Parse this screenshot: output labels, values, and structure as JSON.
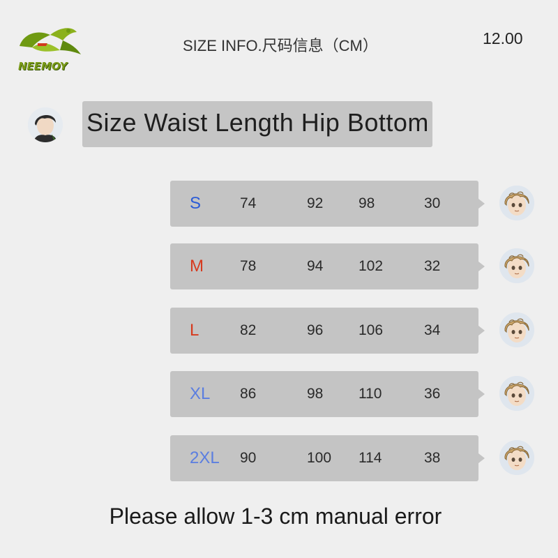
{
  "brand": {
    "logo_text": "NEEMOY",
    "logo_color": "#7a9a18"
  },
  "header": {
    "title": "SIZE INFO.尺码信息（CM）",
    "price": "12.00"
  },
  "columns": {
    "line": "Size Waist Length Hip Bottom"
  },
  "rows": [
    {
      "size": "S",
      "color": "#2a5bd7",
      "waist": "74",
      "length": "92",
      "hip": "98",
      "bottom": "30"
    },
    {
      "size": "M",
      "color": "#d63a1e",
      "waist": "78",
      "length": "94",
      "hip": "102",
      "bottom": "32"
    },
    {
      "size": "L",
      "color": "#d63a1e",
      "waist": "82",
      "length": "96",
      "hip": "106",
      "bottom": "34"
    },
    {
      "size": "XL",
      "color": "#5b7ee0",
      "waist": "86",
      "length": "98",
      "hip": "110",
      "bottom": "36"
    },
    {
      "size": "2XL",
      "color": "#5b7ee0",
      "waist": "90",
      "length": "100",
      "hip": "114",
      "bottom": "38"
    }
  ],
  "footer": {
    "note": "Please allow 1-3 cm manual error"
  },
  "icons": {
    "header_avatar": "dark-hair-avatar-icon",
    "row_avatar": "curly-blond-avatar-icon"
  }
}
